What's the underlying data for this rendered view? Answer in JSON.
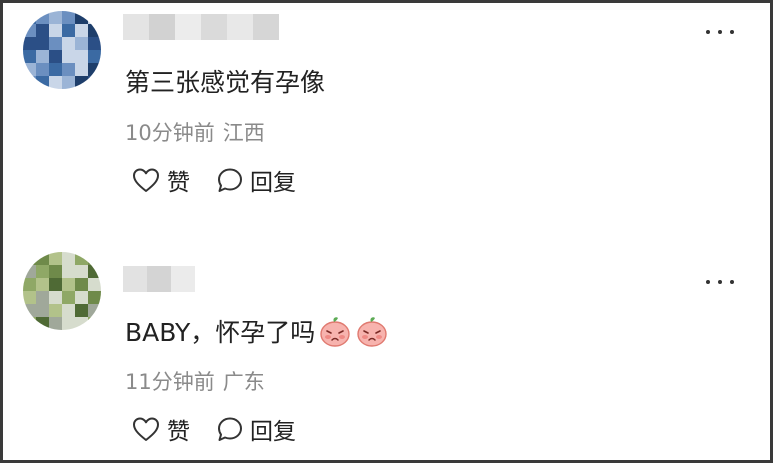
{
  "comments": [
    {
      "username_masked": true,
      "text": "第三张感觉有孕像",
      "emojis": [],
      "time": "10分钟前",
      "location": "江西",
      "like_label": "赞",
      "reply_label": "回复",
      "avatar_colors": [
        "#1e3e6b",
        "#3b6aa3",
        "#6b8fc0",
        "#9bb4d6",
        "#2b4f86",
        "#c9d6e8"
      ]
    },
    {
      "username_masked": true,
      "text": "BABY，怀孕了吗",
      "emojis": [
        "pouting-peach-emoji",
        "pouting-peach-emoji"
      ],
      "time": "11分钟前",
      "location": "广东",
      "like_label": "赞",
      "reply_label": "回复",
      "avatar_colors": [
        "#6f8a4a",
        "#8fa866",
        "#b2c28a",
        "#4f6a35",
        "#a0a89a",
        "#d6dccd"
      ]
    }
  ]
}
